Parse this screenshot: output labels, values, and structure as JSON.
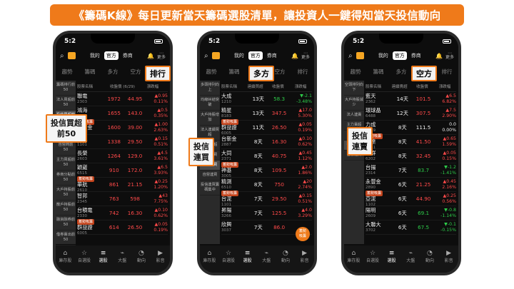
{
  "banner": "《籌碼K線》每日更新當天籌碼選股清單，讓投資人一鍵得知當天投信動向",
  "phones": [
    {
      "time": "5:2",
      "seg": [
        "我的",
        "官方",
        "券商"
      ],
      "more": "更多",
      "tabs": [
        "趨勢",
        "籌碼",
        "多方",
        "空方",
        "排行"
      ],
      "active_tab": 4,
      "highlight": "排行",
      "callout": [
        "投信買超",
        "前50"
      ],
      "side": [
        "籌碼排行前50",
        "法人買超前50",
        "投信買超前50",
        "外資買超前50",
        "自營商前50",
        "主力買超前50",
        "券商分點前50",
        "大戶持股前50",
        "散戶持股前50",
        "融資融券前50",
        "借券賣出前50"
      ],
      "header": [
        "股票名稱",
        "收盤價 (6/29)",
        "漲跌幅"
      ],
      "rows": [
        {
          "tag": "",
          "name": "聯電",
          "code": "2303",
          "mid": "1972",
          "p": "44.95",
          "d": "▲0.95",
          "pct": "0.11%"
        },
        {
          "tag": "",
          "name": "鴻海",
          "code": "2317",
          "mid": "1655",
          "p": "143.0",
          "d": "▲0.5",
          "pct": "0.35%"
        },
        {
          "tag": "蓄勢吸籌",
          "name": "中信金",
          "code": "2891",
          "mid": "1600",
          "p": "39.00",
          "d": "▲1.00",
          "pct": "2.63%"
        },
        {
          "tag": "",
          "name": "台泥",
          "code": "1101",
          "mid": "1338",
          "p": "29.50",
          "d": "▲0.15",
          "pct": "0.51%"
        },
        {
          "tag": "",
          "name": "長榮",
          "code": "2603",
          "mid": "1264",
          "p": "129.0",
          "d": "▲4.5",
          "pct": "3.61%"
        },
        {
          "tag": "",
          "name": "穎崴",
          "code": "6515",
          "mid": "910",
          "p": "172.0",
          "d": "▲6.5",
          "pct": "3.93%"
        },
        {
          "tag": "蓄勢吸籌",
          "name": "華航",
          "code": "2610",
          "mid": "861",
          "p": "21.15",
          "d": "▲0.25",
          "pct": "1.20%"
        },
        {
          "tag": "",
          "name": "智邦",
          "code": "2345",
          "mid": "763",
          "p": "598",
          "d": "▲43",
          "pct": "7.75%"
        },
        {
          "tag": "",
          "name": "台積電",
          "code": "2330",
          "mid": "742",
          "p": "16.30",
          "d": "▲0.10",
          "pct": "0.62%"
        },
        {
          "tag": "蓄勢吸籌",
          "name": "群益證",
          "code": "6005",
          "mid": "614",
          "p": "26.50",
          "d": "▲0.05",
          "pct": "0.19%"
        }
      ],
      "nav": [
        "庫存股",
        "自選股",
        "選股",
        "大盤",
        "動向",
        "影音"
      ]
    },
    {
      "time": "5:2",
      "seg": [
        "我的",
        "官方",
        "券商"
      ],
      "more": "更多",
      "tabs": [
        "趨勢",
        "籌碼",
        "多方",
        "空方",
        "排行"
      ],
      "active_tab": 2,
      "highlight": "多方",
      "callout": [
        "投信",
        "連買"
      ],
      "side": [
        "多頭排列向上",
        "均線糾結突破",
        "大戶持股增加",
        "法人連續買超",
        "主力買超",
        "外資連買",
        "投信連買",
        "自營連買",
        "投信連買籌碼集中"
      ],
      "header": [
        "股票名稱",
        "連續買超",
        "收盤價",
        "漲跌幅"
      ],
      "rows": [
        {
          "tag": "",
          "name": "大成",
          "code": "1210",
          "mid": "13天",
          "p": "58.3",
          "d": "▼-2.1",
          "pct": "-3.48%",
          "g": true
        },
        {
          "tag": "",
          "name": "精星",
          "code": "8183",
          "mid": "13天",
          "p": "347.5",
          "d": "▲17.0",
          "pct": "5.30%"
        },
        {
          "tag": "蓄勢吸籌",
          "name": "群益證",
          "code": "6005",
          "mid": "11天",
          "p": "26.50",
          "d": "▲0.05",
          "pct": "0.19%"
        },
        {
          "tag": "",
          "name": "台新金",
          "code": "2887",
          "mid": "8天",
          "p": "16.30",
          "d": "▲0.10",
          "pct": "0.62%"
        },
        {
          "tag": "",
          "name": "大同",
          "code": "2371",
          "mid": "8天",
          "p": "40.75",
          "d": "▲0.45",
          "pct": "1.12%"
        },
        {
          "tag": "蓄勢吸籌",
          "name": "神基",
          "code": "3005",
          "mid": "8天",
          "p": "109.5",
          "d": "▲2.0",
          "pct": "1.86%"
        },
        {
          "tag": "",
          "name": "精測",
          "code": "6510",
          "mid": "8天",
          "p": "750",
          "d": "▲20",
          "pct": "2.74%"
        },
        {
          "tag": "蓄勢吸籌",
          "name": "台泥",
          "code": "1101",
          "mid": "7天",
          "p": "29.50",
          "d": "▲0.15",
          "pct": "0.51%"
        },
        {
          "tag": "",
          "name": "昇陽",
          "code": "3266",
          "mid": "7天",
          "p": "125.5",
          "d": "▲4.0",
          "pct": "3.29%"
        },
        {
          "tag": "",
          "name": "欣興",
          "code": "3037",
          "mid": "7天",
          "p": "86.0",
          "d": "",
          "pct": ""
        }
      ],
      "fab": [
        "蓄勢",
        "吸籌"
      ],
      "nav": [
        "庫存股",
        "自選股",
        "選股",
        "大盤",
        "動向",
        "影音"
      ]
    },
    {
      "time": "5:2",
      "seg": [
        "我的",
        "官方",
        "券商"
      ],
      "more": "更多",
      "tabs": [
        "趨勢",
        "籌碼",
        "多方",
        "空方",
        "排行"
      ],
      "active_tab": 3,
      "highlight": "空方",
      "callout": [
        "投信",
        "連賣"
      ],
      "side": [
        "空頭排列向下",
        "大戶持股減少",
        "法人連賣",
        "主力賣超",
        "外資連賣",
        "投信連賣",
        "自營連賣"
      ],
      "header": [
        "股票名稱",
        "連續賣超",
        "收盤價",
        "漲跌幅"
      ],
      "rows": [
        {
          "tag": "",
          "name": "藍天",
          "code": "2362",
          "mid": "14天",
          "p": "101.5",
          "d": "▲6.5",
          "pct": "6.82%"
        },
        {
          "tag": "",
          "name": "環球晶",
          "code": "6488",
          "mid": "12天",
          "p": "307.5",
          "d": "▲7.5",
          "pct": "2.90%"
        },
        {
          "tag": "",
          "name": "力成",
          "code": "6239",
          "mid": "8天",
          "p": "111.5",
          "d": "0.0",
          "pct": "0.00%",
          "w": true
        },
        {
          "tag": "蓄勢吸籌",
          "name": "樂達",
          "code": "3581",
          "mid": "8天",
          "p": "41.50",
          "d": "▲0.65",
          "pct": "1.59%"
        },
        {
          "tag": "",
          "name": "盛群",
          "code": "6202",
          "mid": "8天",
          "p": "32.45",
          "d": "▲0.05",
          "pct": "0.15%"
        },
        {
          "tag": "",
          "name": "台揚",
          "code": "2314",
          "mid": "7天",
          "p": "83.7",
          "d": "▼-1.2",
          "pct": "-1.41%",
          "g": true
        },
        {
          "tag": "",
          "name": "永豐金",
          "code": "2890",
          "mid": "6天",
          "p": "21.25",
          "d": "▲0.45",
          "pct": "2.16%"
        },
        {
          "tag": "蓄勢吸籌",
          "name": "亞泥",
          "code": "1102",
          "mid": "6天",
          "p": "44.90",
          "d": "▲0.25",
          "pct": "0.56%"
        },
        {
          "tag": "",
          "name": "陽明",
          "code": "2609",
          "mid": "6天",
          "p": "69.1",
          "d": "▼-0.8",
          "pct": "-1.14%",
          "g": true
        },
        {
          "tag": "",
          "name": "大聯大",
          "code": "3702",
          "mid": "6天",
          "p": "67.5",
          "d": "▼-0.1",
          "pct": "-0.15%",
          "g": true
        }
      ],
      "nav": [
        "庫存股",
        "自選股",
        "選股",
        "大盤",
        "動向",
        "影音"
      ]
    }
  ]
}
